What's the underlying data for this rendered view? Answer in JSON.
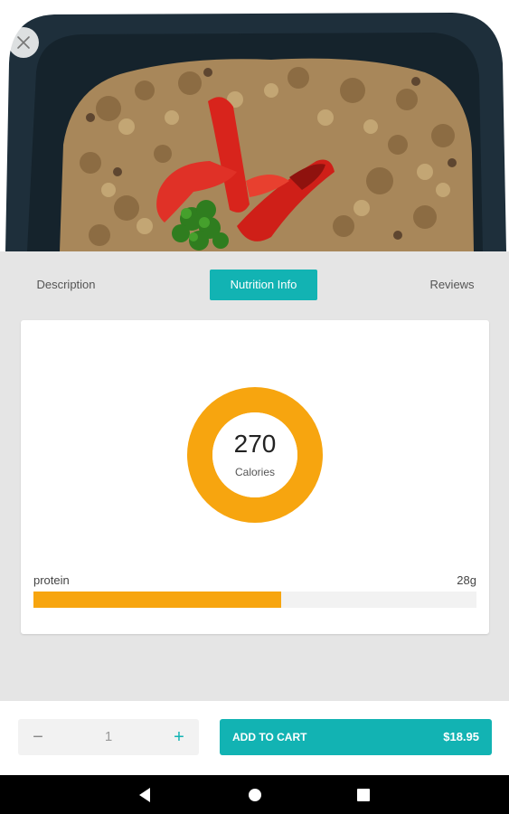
{
  "colors": {
    "accent": "#12b3b3",
    "calorie_ring": "#f7a50f",
    "protein_bar": "#f7a50f",
    "background": "#e5e5e5"
  },
  "hero": {
    "close_icon": "close-icon"
  },
  "tabs": [
    {
      "label": "Description",
      "active": false
    },
    {
      "label": "Nutrition Info",
      "active": true
    },
    {
      "label": "Reviews",
      "active": false
    }
  ],
  "nutrition": {
    "calories_value": "270",
    "calories_label": "Calories",
    "nutrients": [
      {
        "name": "protein",
        "amount": "28g",
        "fill_fraction": 0.56
      }
    ]
  },
  "cart": {
    "minus_symbol": "−",
    "quantity": "1",
    "plus_symbol": "+",
    "add_label": "ADD TO CART",
    "price": "$18.95"
  },
  "system_nav": {
    "back_icon": "back-triangle-icon",
    "home_icon": "home-circle-icon",
    "recents_icon": "recents-square-icon"
  }
}
